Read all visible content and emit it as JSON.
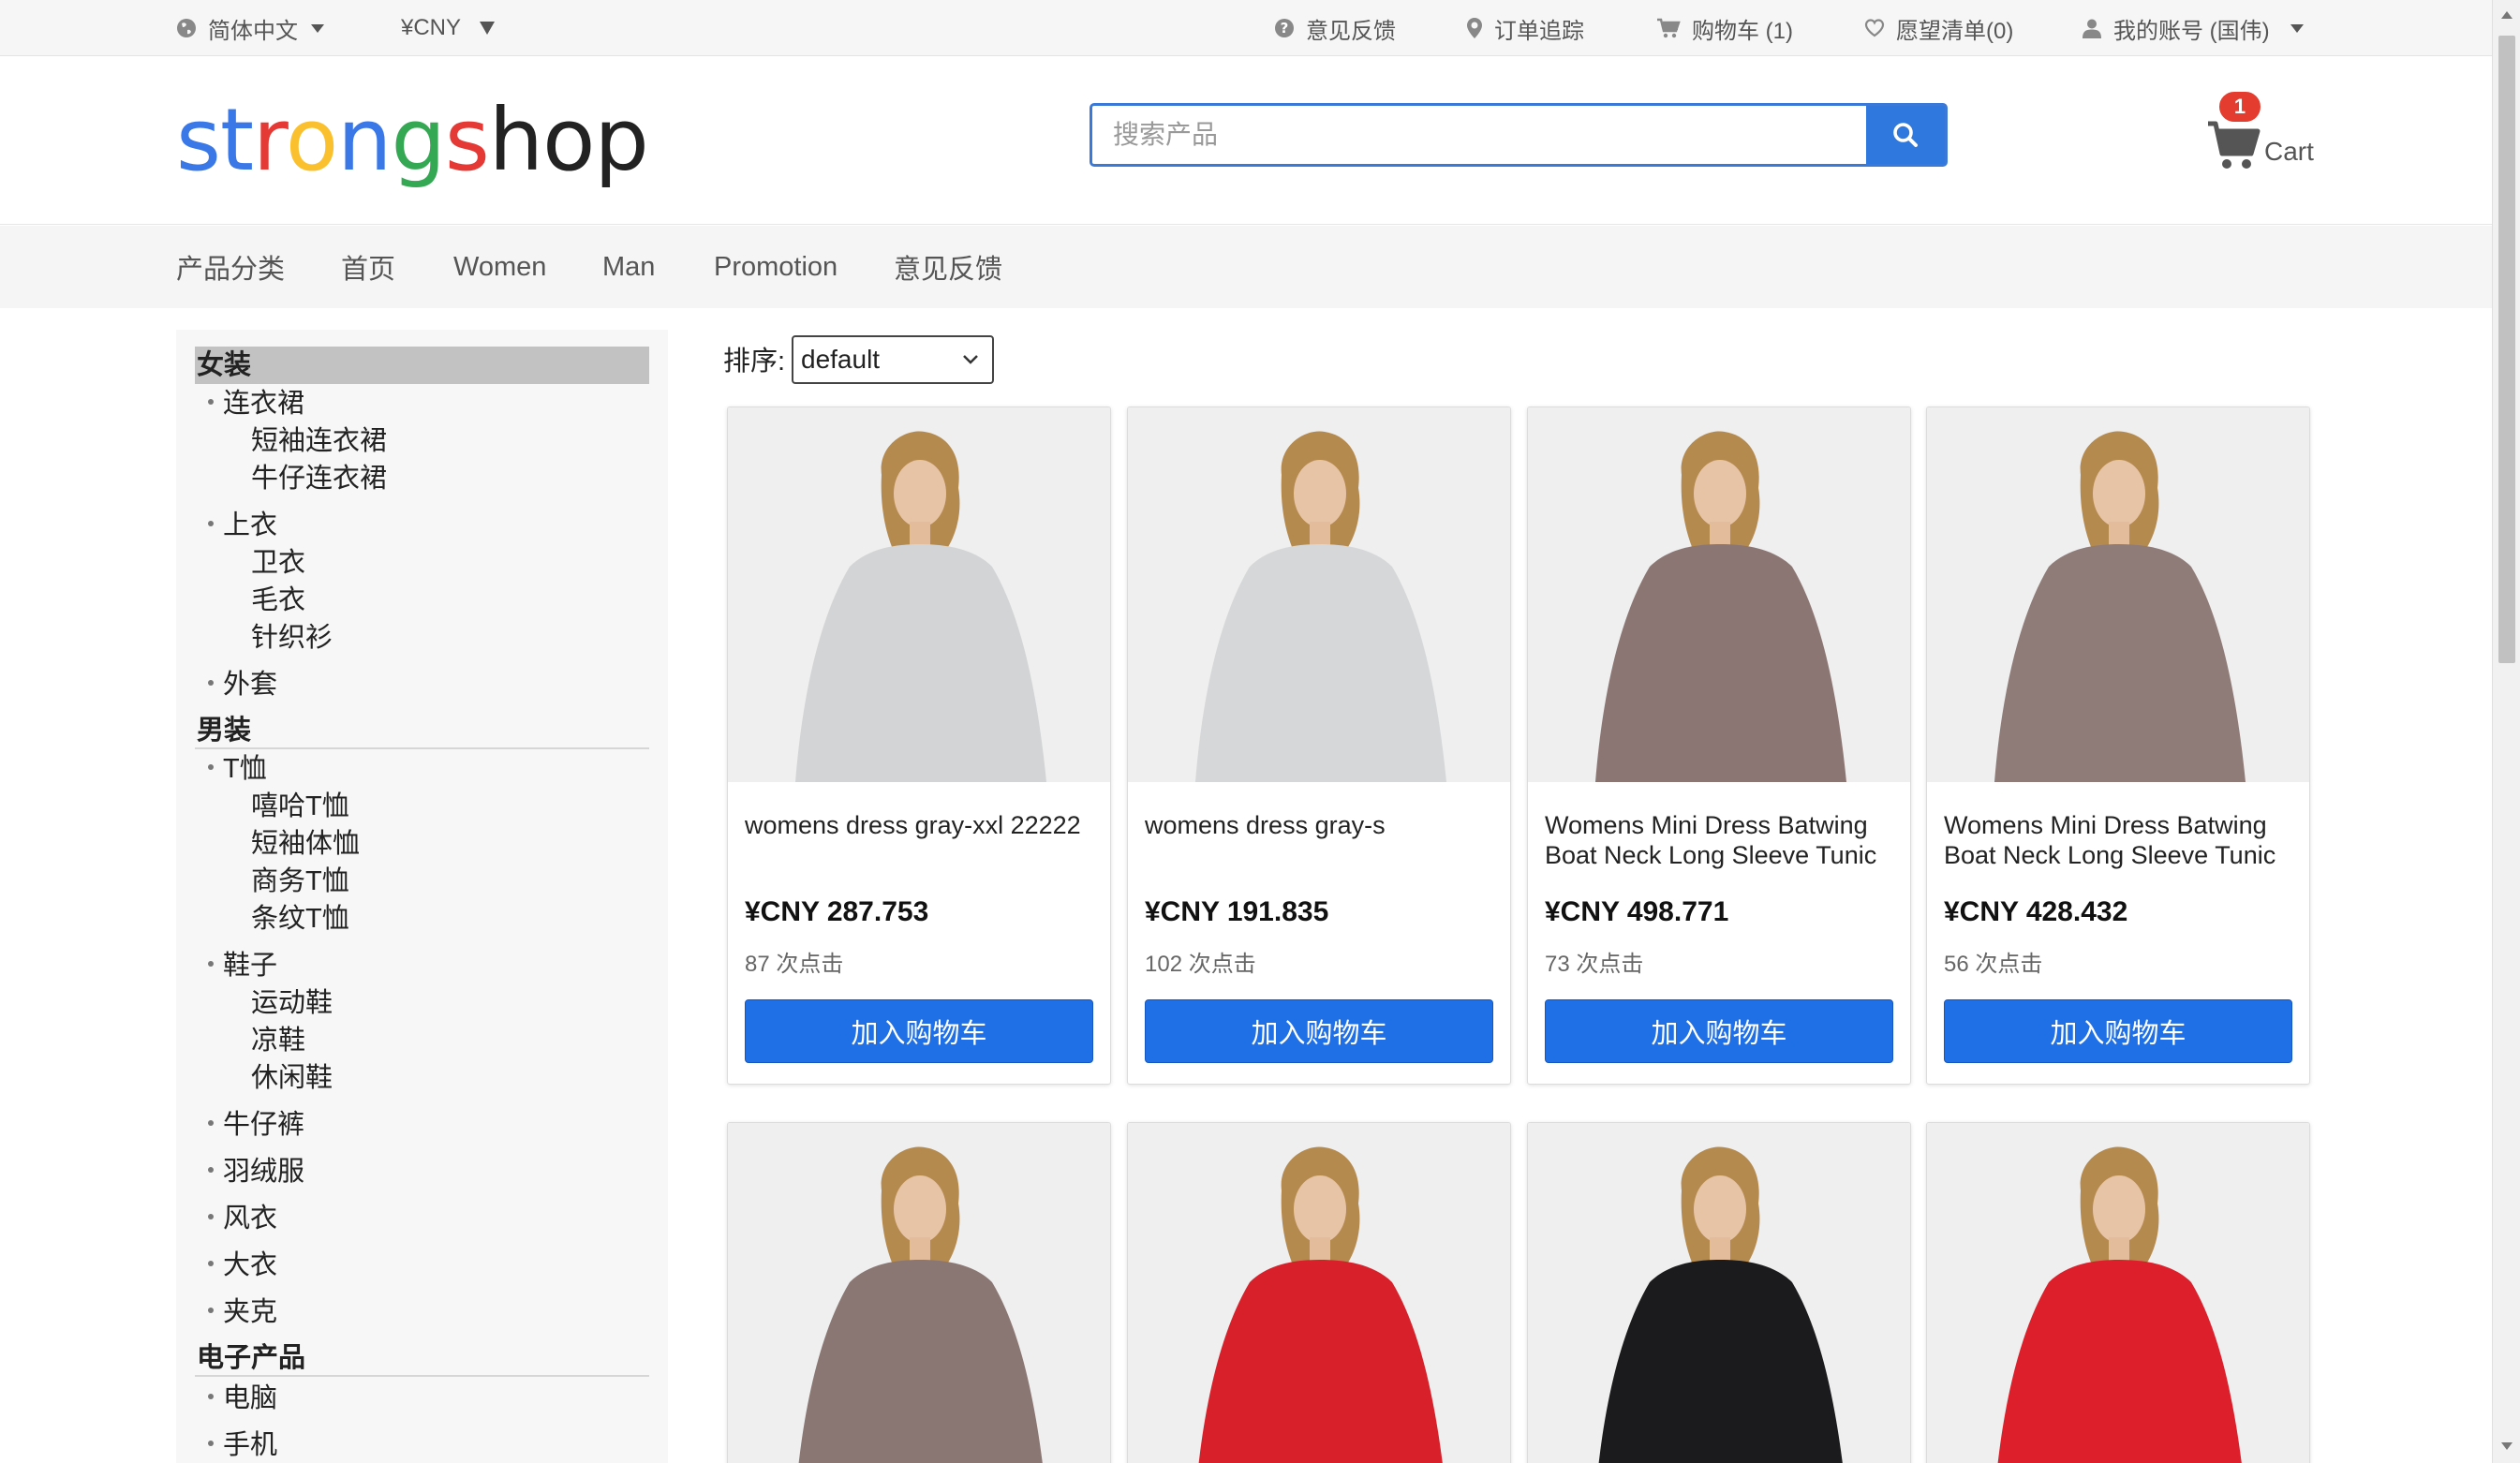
{
  "topbar": {
    "language": "简体中文",
    "currency": "¥CNY",
    "feedback": "意见反馈",
    "order_tracking": "订单追踪",
    "cart": "购物车 (1)",
    "wishlist": "愿望清单(0)",
    "account": "我的账号 (国伟)"
  },
  "header": {
    "logo_letters": [
      {
        "ch": "s",
        "color": "#3b78e7"
      },
      {
        "ch": "t",
        "color": "#3b78e7"
      },
      {
        "ch": "r",
        "color": "#e53935"
      },
      {
        "ch": "o",
        "color": "#fbc02d"
      },
      {
        "ch": "n",
        "color": "#3b78e7"
      },
      {
        "ch": "g",
        "color": "#34a853"
      },
      {
        "ch": "s",
        "color": "#e53935"
      },
      {
        "ch": "h",
        "color": "#222222"
      },
      {
        "ch": "o",
        "color": "#222222"
      },
      {
        "ch": "p",
        "color": "#222222"
      }
    ],
    "search_placeholder": "搜索产品",
    "search_icon": "magnifier-icon",
    "cart_badge": "1",
    "cart_label": "Cart"
  },
  "nav": {
    "items": [
      "产品分类",
      "首页",
      "Women",
      "Man",
      "Promotion",
      "意见反馈"
    ]
  },
  "sidebar": {
    "women": {
      "title": "女装",
      "dress": "连衣裙",
      "dress_short": "短袖连衣裙",
      "dress_denim": "牛仔连衣裙",
      "tops": "上衣",
      "hoodie": "卫衣",
      "sweater": "毛衣",
      "knit": "针织衫",
      "coat": "外套"
    },
    "men": {
      "title": "男装",
      "tshirt": "T恤",
      "hiphop": "嘻哈T恤",
      "short_sleeve": "短袖体恤",
      "business": "商务T恤",
      "striped": "条纹T恤",
      "shoes": "鞋子",
      "sports": "运动鞋",
      "sandals": "凉鞋",
      "casual": "休闲鞋",
      "jeans": "牛仔裤",
      "down": "羽绒服",
      "windbreaker": "风衣",
      "overcoat": "大衣",
      "jacket": "夹克"
    },
    "electronics": {
      "title": "电子产品",
      "computer": "电脑",
      "phone": "手机"
    }
  },
  "sort": {
    "label": "排序:",
    "selected": "default"
  },
  "products": [
    {
      "name": "womens dress gray-xxl 22222",
      "price": "¥CNY 287.753",
      "clicks": "87 次点击",
      "button": "加入购物车",
      "dress_color": "#d3d4d6"
    },
    {
      "name": "womens dress gray-s",
      "price": "¥CNY 191.835",
      "clicks": "102 次点击",
      "button": "加入购物车",
      "dress_color": "#d6d7d9"
    },
    {
      "name": "Womens Mini Dress Batwing Boat Neck Long Sleeve Tunic",
      "price": "¥CNY 498.771",
      "clicks": "73 次点击",
      "button": "加入购物车",
      "dress_color": "#8c7674"
    },
    {
      "name": "Womens Mini Dress Batwing Boat Neck Long Sleeve Tunic",
      "price": "¥CNY 428.432",
      "clicks": "56 次点击",
      "button": "加入购物车",
      "dress_color": "#8f7b78"
    },
    {
      "dress_color": "#8a7673"
    },
    {
      "dress_color": "#d8202a"
    },
    {
      "dress_color": "#1b1b1d"
    },
    {
      "dress_color": "#dc1f2b"
    }
  ]
}
